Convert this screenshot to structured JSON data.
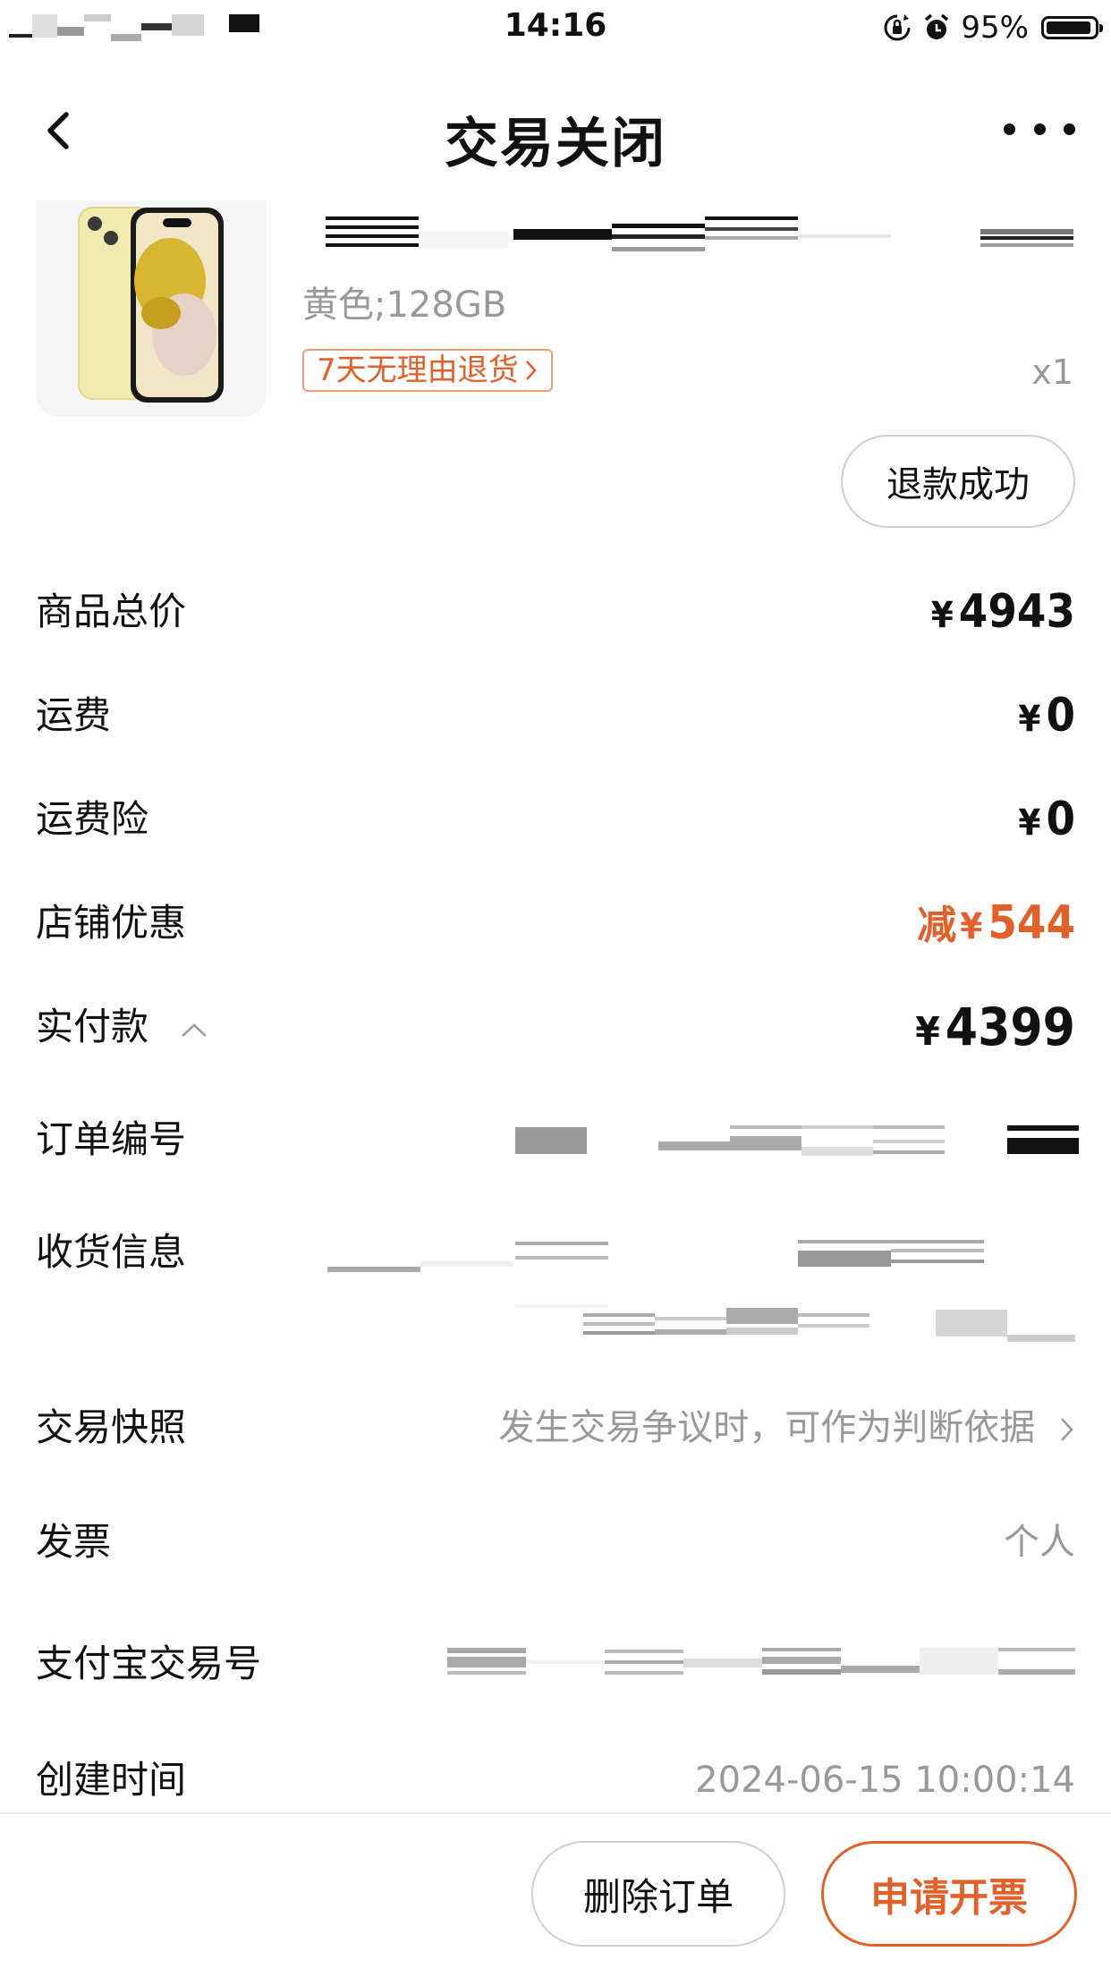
{
  "status_bar": {
    "time": "14:16",
    "battery": "95%",
    "battery_level": 0.95
  },
  "nav": {
    "title": "交易关闭"
  },
  "product": {
    "variant": "黄色;128GB",
    "return_policy": "7天无理由退货",
    "quantity": "x1",
    "refund_status": "退款成功"
  },
  "summary": {
    "total_label": "商品总价",
    "total_value": "4943",
    "shipping_label": "运费",
    "shipping_value": "0",
    "shipping_ins_label": "运费险",
    "shipping_ins_value": "0",
    "store_discount_label": "店铺优惠",
    "store_discount_prefix": "减",
    "store_discount_value": "544",
    "paid_label": "实付款",
    "paid_value": "4399",
    "currency": "¥"
  },
  "details": {
    "order_no_label": "订单编号",
    "shipping_info_label": "收货信息",
    "snapshot_label": "交易快照",
    "snapshot_value": "发生交易争议时，可作为判断依据",
    "invoice_label": "发票",
    "invoice_value": "个人",
    "alipay_label": "支付宝交易号",
    "created_label": "创建时间",
    "created_value": "2024-06-15 10:00:14"
  },
  "bottom": {
    "delete_label": "删除订单",
    "invoice_label": "申请开票"
  },
  "colors": {
    "accent": "#e0612a",
    "badge_border": "#e8a07b",
    "muted": "#999999"
  }
}
